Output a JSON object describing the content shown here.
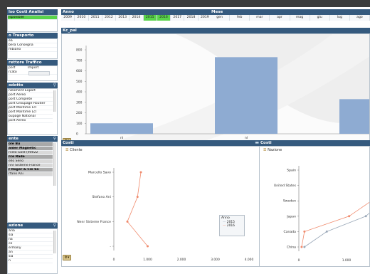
{
  "left_panels": {
    "analisi": {
      "title": "lso Costi Analisi",
      "items": [
        {
          "label": "isponibile",
          "state": "sel"
        }
      ]
    },
    "trasporto": {
      "title": "o Trasporto",
      "items": [
        {
          "label": "ea",
          "state": ""
        },
        {
          "label": "bera Consegna",
          "state": ""
        },
        {
          "label": "mbiano",
          "state": ""
        }
      ]
    },
    "traffico": {
      "title": "rettore Traffico",
      "columns": [
        "port",
        "Import"
      ],
      "items": [
        {
          "label": "rcato",
          "state": ""
        }
      ]
    },
    "prodotto": {
      "title": "odotto",
      "items": [
        {
          "label": "nsloment Export",
          "state": ""
        },
        {
          "label": "port Aereo",
          "state": ""
        },
        {
          "label": "port Complete",
          "state": ""
        },
        {
          "label": "port Groupage Routier",
          "state": ""
        },
        {
          "label": "port Maritime Fcl",
          "state": ""
        },
        {
          "label": "port Maritime Lcl",
          "state": ""
        },
        {
          "label": "oupage National",
          "state": ""
        },
        {
          "label": "port Aereo",
          "state": ""
        }
      ]
    },
    "cliente": {
      "title": "ente",
      "items": [
        {
          "label": "ole Bu",
          "state": "dark"
        },
        {
          "label": "alder Magnetic",
          "state": "dark"
        },
        {
          "label": "rvelo Gold (90022",
          "state": "mid"
        },
        {
          "label": "rce Rade",
          "state": "dark"
        },
        {
          "label": "ello Seno",
          "state": "mid"
        },
        {
          "label": "nnr Sisteme France",
          "state": "mid"
        },
        {
          "label": "r Roger & Cie Sa",
          "state": "dark"
        },
        {
          "label": "rfano Ani",
          "state": "mid"
        }
      ]
    },
    "nazione": {
      "title": "azione",
      "items": [
        {
          "label": "aria",
          "state": ""
        },
        {
          "label": "sia",
          "state": ""
        },
        {
          "label": "na",
          "state": ""
        },
        {
          "label": "ce",
          "state": ""
        },
        {
          "label": "ermany",
          "state": ""
        },
        {
          "label": "an",
          "state": ""
        },
        {
          "label": "sia",
          "state": ""
        },
        {
          "label": "n",
          "state": ""
        }
      ]
    }
  },
  "anno": {
    "title": "Anno",
    "years": [
      {
        "label": "2009",
        "sel": false
      },
      {
        "label": "2010",
        "sel": false
      },
      {
        "label": "2011",
        "sel": false
      },
      {
        "label": "2012",
        "sel": false
      },
      {
        "label": "2013",
        "sel": false
      },
      {
        "label": "2014",
        "sel": false
      },
      {
        "label": "2015",
        "sel": true
      },
      {
        "label": "2016",
        "sel": true
      },
      {
        "label": "2017",
        "sel": false
      },
      {
        "label": "2018",
        "sel": false
      },
      {
        "label": "2019",
        "sel": false
      }
    ]
  },
  "mese": {
    "title": "Mese",
    "months": [
      "gen",
      "feb",
      "mar",
      "apr",
      "mag",
      "giu",
      "lug",
      "ago"
    ]
  },
  "main_chart_panel": {
    "title": "Kc_pal"
  },
  "costi_cliente": {
    "title": "Costi",
    "subtitle": "Cliente"
  },
  "costi_nazione": {
    "title": "Costi",
    "subtitle": "Nazione"
  },
  "legend": {
    "title": "Anno",
    "items": [
      "2015",
      "2016"
    ]
  },
  "colors": {
    "header": "#355a7e",
    "bar": "#8eabd2",
    "selected": "#58d34a",
    "series_2015": "#9aa8b8",
    "series_2016": "#f08a6c"
  },
  "chart_data": [
    {
      "type": "bar",
      "categories": [
        "nl",
        "nl",
        ""
      ],
      "values": [
        100,
        730,
        330
      ],
      "ylim": [
        0,
        800
      ],
      "yticks": [
        0,
        100,
        200,
        300,
        400,
        500,
        600,
        700,
        800
      ],
      "title": "",
      "xlabel": "",
      "ylabel": ""
    },
    {
      "type": "line",
      "orientation": "horizontal",
      "categories": [
        "Marcello Savo",
        "Stefano Ani",
        "Nenr Sisteme France",
        "-"
      ],
      "series": [
        {
          "name": "2015",
          "values": [
            null,
            null,
            null,
            null
          ]
        },
        {
          "name": "2016",
          "values": [
            800,
            700,
            400,
            1000
          ]
        }
      ],
      "xlim": [
        0,
        4000
      ],
      "xticks": [
        "0",
        "1.000",
        "2.000",
        "3.000",
        "4.000"
      ],
      "title": "",
      "xlabel": "",
      "ylabel": ""
    },
    {
      "type": "line",
      "orientation": "horizontal",
      "categories": [
        "Spain",
        "United States",
        "Sweden",
        "Japan",
        "Canada",
        "China"
      ],
      "series": [
        {
          "name": "2015",
          "values": [
            null,
            2000,
            1500,
            1200,
            500,
            100
          ]
        },
        {
          "name": "2016",
          "values": [
            null,
            null,
            1300,
            900,
            100,
            50
          ]
        }
      ],
      "xlim": [
        0,
        2000
      ],
      "xticks": [
        "0",
        "1.000"
      ],
      "title": "",
      "xlabel": "",
      "ylabel": ""
    }
  ]
}
